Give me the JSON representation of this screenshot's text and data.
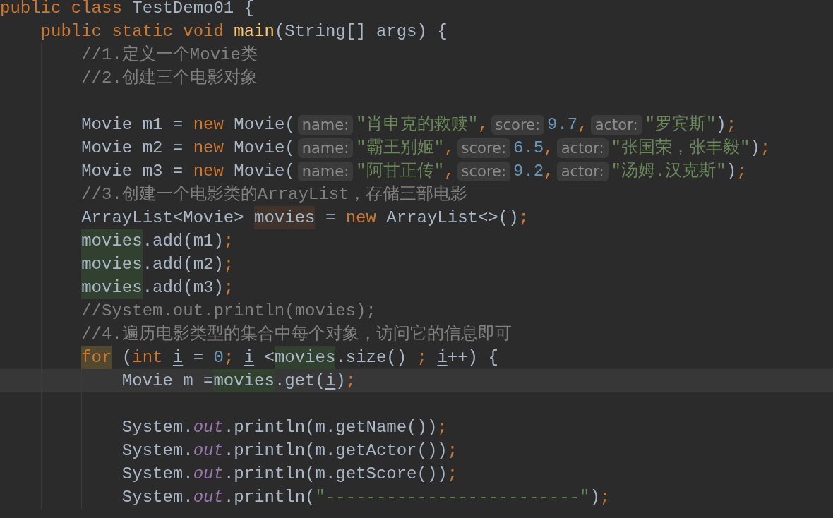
{
  "editor": {
    "lines": [
      {
        "current": false,
        "tokens": [
          {
            "kind": "kw",
            "text": "public class "
          },
          {
            "kind": "text",
            "text": "TestDemo01 {"
          }
        ],
        "children": [
          {
            "current": false,
            "tokens": [
              {
                "kind": "kw",
                "text": "public static void "
              },
              {
                "kind": "method",
                "text": "main"
              },
              {
                "kind": "text",
                "text": "(String[] args) {"
              }
            ],
            "children": [
              {
                "current": false,
                "tokens": [
                  {
                    "kind": "comment",
                    "text": "//1.定义一个Movie类"
                  }
                ]
              },
              {
                "current": false,
                "tokens": [
                  {
                    "kind": "comment",
                    "text": "//2.创建三个电影对象"
                  }
                ]
              },
              {
                "current": false
              },
              {
                "current": false,
                "tokens": [
                  {
                    "kind": "text",
                    "text": "Movie m1 = "
                  },
                  {
                    "kind": "kw",
                    "text": "new "
                  },
                  {
                    "kind": "text",
                    "text": "Movie("
                  },
                  {
                    "kind": "hint",
                    "text": "name:"
                  },
                  {
                    "kind": "str",
                    "text": "\"肖申克的救赎\""
                  },
                  {
                    "kind": "kw",
                    "text": ","
                  },
                  {
                    "kind": "hint",
                    "text": "score:"
                  },
                  {
                    "kind": "num",
                    "text": "9.7"
                  },
                  {
                    "kind": "kw",
                    "text": ","
                  },
                  {
                    "kind": "hint",
                    "text": "actor:"
                  },
                  {
                    "kind": "str",
                    "text": "\"罗宾斯\""
                  },
                  {
                    "kind": "text",
                    "text": ")"
                  },
                  {
                    "kind": "kw",
                    "text": ";"
                  }
                ]
              },
              {
                "current": false,
                "tokens": [
                  {
                    "kind": "text",
                    "text": "Movie m2 = "
                  },
                  {
                    "kind": "kw",
                    "text": "new "
                  },
                  {
                    "kind": "text",
                    "text": "Movie("
                  },
                  {
                    "kind": "hint",
                    "text": "name:"
                  },
                  {
                    "kind": "str",
                    "text": "\"霸王别姬\""
                  },
                  {
                    "kind": "kw",
                    "text": ","
                  },
                  {
                    "kind": "hint",
                    "text": "score:"
                  },
                  {
                    "kind": "num",
                    "text": "6.5"
                  },
                  {
                    "kind": "kw",
                    "text": ","
                  },
                  {
                    "kind": "hint",
                    "text": "actor:"
                  },
                  {
                    "kind": "str",
                    "text": "\"张国荣，张丰毅\""
                  },
                  {
                    "kind": "text",
                    "text": ")"
                  },
                  {
                    "kind": "kw",
                    "text": ";"
                  }
                ]
              },
              {
                "current": false,
                "tokens": [
                  {
                    "kind": "text",
                    "text": "Movie m3 = "
                  },
                  {
                    "kind": "kw",
                    "text": "new "
                  },
                  {
                    "kind": "text",
                    "text": "Movie("
                  },
                  {
                    "kind": "hint",
                    "text": "name:"
                  },
                  {
                    "kind": "str",
                    "text": "\"阿甘正传\""
                  },
                  {
                    "kind": "kw",
                    "text": ","
                  },
                  {
                    "kind": "hint",
                    "text": "score:"
                  },
                  {
                    "kind": "num",
                    "text": "9.2"
                  },
                  {
                    "kind": "kw",
                    "text": ","
                  },
                  {
                    "kind": "hint",
                    "text": "actor:"
                  },
                  {
                    "kind": "str",
                    "text": "\"汤姆.汉克斯\""
                  },
                  {
                    "kind": "text",
                    "text": ")"
                  },
                  {
                    "kind": "kw",
                    "text": ";"
                  }
                ]
              },
              {
                "current": false,
                "tokens": [
                  {
                    "kind": "comment",
                    "text": "//3.创建一个电影类的ArrayList，存储三部电影"
                  }
                ]
              },
              {
                "current": false,
                "tokens": [
                  {
                    "kind": "text",
                    "text": "ArrayList<Movie> "
                  },
                  {
                    "kind": "write",
                    "text": "movies"
                  },
                  {
                    "kind": "text",
                    "text": " = "
                  },
                  {
                    "kind": "kw",
                    "text": "new "
                  },
                  {
                    "kind": "text",
                    "text": "ArrayList<>()"
                  },
                  {
                    "kind": "kw",
                    "text": ";"
                  }
                ]
              },
              {
                "current": false,
                "tokens": [
                  {
                    "kind": "read",
                    "text": "movies"
                  },
                  {
                    "kind": "text",
                    "text": ".add(m1)"
                  },
                  {
                    "kind": "kw",
                    "text": ";"
                  }
                ]
              },
              {
                "current": false,
                "tokens": [
                  {
                    "kind": "read",
                    "text": "movies"
                  },
                  {
                    "kind": "text",
                    "text": ".add(m2)"
                  },
                  {
                    "kind": "kw",
                    "text": ";"
                  }
                ]
              },
              {
                "current": false,
                "tokens": [
                  {
                    "kind": "read",
                    "text": "movies"
                  },
                  {
                    "kind": "text",
                    "text": ".add(m3)"
                  },
                  {
                    "kind": "kw",
                    "text": ";"
                  }
                ]
              },
              {
                "current": false,
                "tokens": [
                  {
                    "kind": "comment",
                    "text": "//System.out.println(movies);"
                  }
                ]
              },
              {
                "current": false,
                "tokens": [
                  {
                    "kind": "comment",
                    "text": "//4.遍历电影类型的集合中每个对象，访问它的信息即可"
                  }
                ]
              },
              {
                "current": false,
                "tokens": [
                  {
                    "kind": "kwmark",
                    "text": "for"
                  },
                  {
                    "kind": "text",
                    "text": " ("
                  },
                  {
                    "kind": "kw",
                    "text": "int "
                  },
                  {
                    "kind": "var",
                    "text": "i"
                  },
                  {
                    "kind": "text",
                    "text": " = "
                  },
                  {
                    "kind": "num",
                    "text": "0"
                  },
                  {
                    "kind": "kw",
                    "text": "; "
                  },
                  {
                    "kind": "var",
                    "text": "i"
                  },
                  {
                    "kind": "text",
                    "text": " <"
                  },
                  {
                    "kind": "read",
                    "text": "movies"
                  },
                  {
                    "kind": "text",
                    "text": ".size() "
                  },
                  {
                    "kind": "kw",
                    "text": "; "
                  },
                  {
                    "kind": "var",
                    "text": "i"
                  },
                  {
                    "kind": "text",
                    "text": "++) {"
                  }
                ],
                "children": [
                  {
                    "current": true,
                    "tokens": [
                      {
                        "kind": "text",
                        "text": "Movie m ="
                      },
                      {
                        "kind": "read",
                        "text": "movies"
                      },
                      {
                        "kind": "text",
                        "text": ".get("
                      },
                      {
                        "kind": "var",
                        "text": "i"
                      },
                      {
                        "kind": "text",
                        "text": ")"
                      },
                      {
                        "kind": "kw",
                        "text": ";"
                      }
                    ]
                  },
                  {
                    "current": false
                  },
                  {
                    "current": false,
                    "tokens": [
                      {
                        "kind": "text",
                        "text": "System."
                      },
                      {
                        "kind": "field",
                        "text": "out"
                      },
                      {
                        "kind": "text",
                        "text": ".println(m.getName())"
                      },
                      {
                        "kind": "kw",
                        "text": ";"
                      }
                    ]
                  },
                  {
                    "current": false,
                    "tokens": [
                      {
                        "kind": "text",
                        "text": "System."
                      },
                      {
                        "kind": "field",
                        "text": "out"
                      },
                      {
                        "kind": "text",
                        "text": ".println(m.getActor())"
                      },
                      {
                        "kind": "kw",
                        "text": ";"
                      }
                    ]
                  },
                  {
                    "current": false,
                    "tokens": [
                      {
                        "kind": "text",
                        "text": "System."
                      },
                      {
                        "kind": "field",
                        "text": "out"
                      },
                      {
                        "kind": "text",
                        "text": ".println(m.getScore())"
                      },
                      {
                        "kind": "kw",
                        "text": ";"
                      }
                    ]
                  },
                  {
                    "current": false,
                    "tokens": [
                      {
                        "kind": "text",
                        "text": "System."
                      },
                      {
                        "kind": "field",
                        "text": "out"
                      },
                      {
                        "kind": "text",
                        "text": ".println("
                      },
                      {
                        "kind": "str",
                        "text": "\"-------------------------\""
                      },
                      {
                        "kind": "text",
                        "text": ")"
                      },
                      {
                        "kind": "kw",
                        "text": ";"
                      }
                    ]
                  }
                ]
              }
            ]
          }
        ]
      }
    ]
  }
}
